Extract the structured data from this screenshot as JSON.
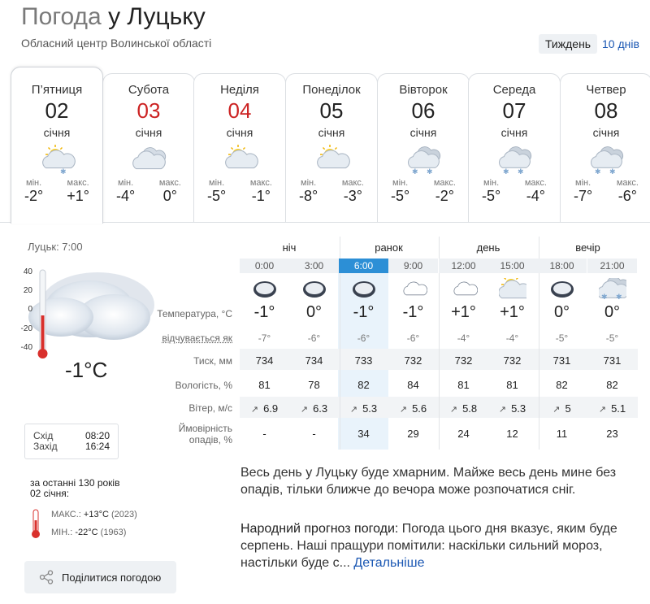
{
  "header": {
    "title_prefix": "Погода",
    "title_city": "у Луцьку",
    "subtitle": "Обласний центр Волинської області",
    "range_week": "Тиждень",
    "range_10": "10 днів"
  },
  "days": [
    {
      "dow": "П’ятниця",
      "day": "02",
      "month": "січня",
      "icon": "partly-cloudy-snow-icon",
      "min_label": "мін.",
      "min": "-2°",
      "max_label": "макс.",
      "max": "+1°"
    },
    {
      "dow": "Субота",
      "day": "03",
      "month": "січня",
      "icon": "cloudy-icon",
      "min_label": "мін.",
      "min": "-4°",
      "max_label": "макс.",
      "max": "0°"
    },
    {
      "dow": "Неділя",
      "day": "04",
      "month": "січня",
      "icon": "partly-cloudy-icon",
      "min_label": "мін.",
      "min": "-5°",
      "max_label": "макс.",
      "max": "-1°"
    },
    {
      "dow": "Понеділок",
      "day": "05",
      "month": "січня",
      "icon": "partly-cloudy-icon",
      "min_label": "мін.",
      "min": "-8°",
      "max_label": "макс.",
      "max": "-3°"
    },
    {
      "dow": "Вівторок",
      "day": "06",
      "month": "січня",
      "icon": "cloudy-snow-icon",
      "min_label": "мін.",
      "min": "-5°",
      "max_label": "макс.",
      "max": "-2°"
    },
    {
      "dow": "Середа",
      "day": "07",
      "month": "січня",
      "icon": "cloudy-snow-icon",
      "min_label": "мін.",
      "min": "-5°",
      "max_label": "макс.",
      "max": "-4°"
    },
    {
      "dow": "Четвер",
      "day": "08",
      "month": "січня",
      "icon": "cloudy-snow-icon",
      "min_label": "мін.",
      "min": "-7°",
      "max_label": "макс.",
      "max": "-6°"
    }
  ],
  "current": {
    "label": "Луцьк: 7:00",
    "temp": "-1°C",
    "scale": [
      "40",
      "20",
      "0",
      "-20",
      "-40"
    ],
    "sunrise_label": "Схід",
    "sunrise": "08:20",
    "sunset_label": "Захід",
    "sunset": "16:24",
    "history_head": "за останні 130 років",
    "history_date": "02 січня:",
    "max_label": "МАКС.:",
    "max_val": "+13°C",
    "max_year": "(2023)",
    "min_label": "МІН.:",
    "min_val": "-22°C",
    "min_year": "(1963)",
    "share": "Поділитися погодою"
  },
  "table": {
    "periods": [
      "ніч",
      "ранок",
      "день",
      "вечір"
    ],
    "labels": {
      "temp": "Температура, °C",
      "feel": "відчувається як",
      "press": "Тиск, мм",
      "hum": "Вологість, %",
      "wind": "Вітер, м/с",
      "prec1": "Ймовірність",
      "prec2": "опадів, %"
    },
    "hours": [
      {
        "time": "0:00",
        "icon": "overcast-icon",
        "temp": "-1°",
        "feel": "-7°",
        "press": "734",
        "hum": "81",
        "wind": "6.9",
        "prec": "-"
      },
      {
        "time": "3:00",
        "icon": "overcast-icon",
        "temp": "0°",
        "feel": "-6°",
        "press": "734",
        "hum": "78",
        "wind": "6.3",
        "prec": "-"
      },
      {
        "time": "6:00",
        "icon": "overcast-icon",
        "temp": "-1°",
        "feel": "-6°",
        "press": "733",
        "hum": "82",
        "wind": "5.3",
        "prec": "34"
      },
      {
        "time": "9:00",
        "icon": "light-cloud-icon",
        "temp": "-1°",
        "feel": "-6°",
        "press": "732",
        "hum": "84",
        "wind": "5.6",
        "prec": "29"
      },
      {
        "time": "12:00",
        "icon": "light-cloud-icon",
        "temp": "+1°",
        "feel": "-4°",
        "press": "732",
        "hum": "81",
        "wind": "5.8",
        "prec": "24"
      },
      {
        "time": "15:00",
        "icon": "partly-cloudy-icon",
        "temp": "+1°",
        "feel": "-4°",
        "press": "732",
        "hum": "81",
        "wind": "5.3",
        "prec": "12"
      },
      {
        "time": "18:00",
        "icon": "overcast-icon",
        "temp": "0°",
        "feel": "-5°",
        "press": "731",
        "hum": "82",
        "wind": "5",
        "prec": "11"
      },
      {
        "time": "21:00",
        "icon": "cloudy-snow-icon",
        "temp": "0°",
        "feel": "-5°",
        "press": "731",
        "hum": "82",
        "wind": "5.1",
        "prec": "23"
      }
    ]
  },
  "description": "Весь день у Луцьку буде хмарним. Майже весь день мине без опадів, тільки ближче до вечора може розпочатися сніг.",
  "folk": {
    "heading": "Народний прогноз погоди:",
    "text": " Погода цього дня вказує, яким буде серпень. Наші пращури помітили: наскільки сильний мороз, настільки буде с... ",
    "more": "Детальніше"
  },
  "colors": {
    "accent": "#2c8fd6",
    "link": "#1a57b3",
    "weekend": "#cc2222"
  }
}
